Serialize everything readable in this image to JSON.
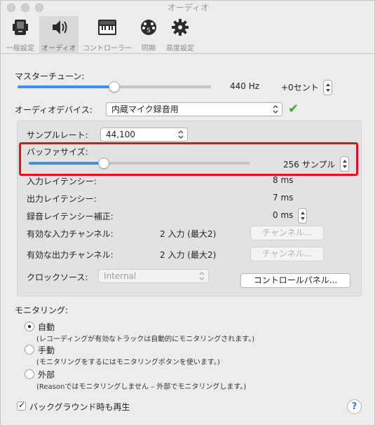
{
  "window": {
    "title": "オーディオ"
  },
  "toolbar": {
    "items": [
      {
        "label": "一般設定",
        "icon": "general-settings-icon"
      },
      {
        "label": "オーディオ",
        "icon": "speaker-icon"
      },
      {
        "label": "コントローラー",
        "icon": "keyboard-controller-icon"
      },
      {
        "label": "同期",
        "icon": "sync-icon"
      },
      {
        "label": "高度設定",
        "icon": "gear-icon"
      }
    ],
    "selected": "オーディオ"
  },
  "master_tune": {
    "label": "マスターチューン:",
    "value": "440 Hz",
    "cents": "+0セント",
    "level": 0.5
  },
  "audio_device": {
    "label": "オーディオデバイス:",
    "value": "内蔵マイク録音用",
    "status_icon": "checkmark-icon",
    "status_color": "#3aa63a"
  },
  "sample_rate": {
    "label": "サンプルレート:",
    "value": "44,100"
  },
  "buffer_size": {
    "label": "バッファサイズ:",
    "value": "256 サンプル",
    "level": 0.34
  },
  "input_latency": {
    "label": "入力レイテンシー:",
    "value": "8 ms"
  },
  "output_latency": {
    "label": "出力レイテンシー:",
    "value": "7 ms"
  },
  "rec_latency": {
    "label": "録音レイテンシー補正:",
    "value": "0 ms"
  },
  "input_channels": {
    "label": "有効な入力チャンネル:",
    "value": "2 入力 (最大2)",
    "button": "チャンネル..."
  },
  "output_channels": {
    "label": "有効な出力チャンネル:",
    "value": "2 入力 (最大2)",
    "button": "チャンネル..."
  },
  "clock_source": {
    "label": "クロックソース:",
    "value": "Internal",
    "button": "コントロールパネル..."
  },
  "monitoring": {
    "label": "モニタリング:",
    "options": [
      {
        "label": "自動",
        "desc": "(レコーディングが有効なトラックは自動的にモニタリングされます。)",
        "selected": true
      },
      {
        "label": "手動",
        "desc": "(モニタリングをするにはモニタリングボタンを使います。)",
        "selected": false
      },
      {
        "label": "外部",
        "desc": "(Reasonではモニタリングしません – 外部でモニタリングします。)",
        "selected": false
      }
    ]
  },
  "background_play": {
    "label": "バックグラウンド時も再生",
    "checked": true
  },
  "help": {
    "label": "?"
  },
  "colors": {
    "accent": "#3d8ef0",
    "highlight": "#e0141e"
  }
}
